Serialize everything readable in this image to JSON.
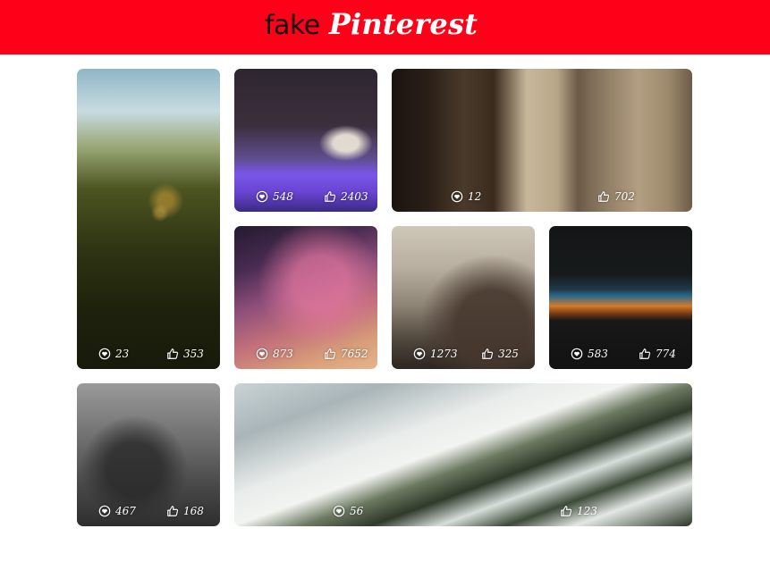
{
  "header": {
    "logo_word1": "fake",
    "logo_word2": "Pinterest",
    "background_color": "#ff0019"
  },
  "icons": {
    "likes": "heart-circle-icon",
    "thumbs": "thumbs-up-icon"
  },
  "tiles": [
    {
      "subject": "grass-field",
      "likes": "23",
      "thumbs": "353"
    },
    {
      "subject": "cathedral-bridge-night",
      "likes": "548",
      "thumbs": "2403"
    },
    {
      "subject": "city-buildings-fire-escape",
      "likes": "12",
      "thumbs": "702"
    },
    {
      "subject": "milky-way-sky",
      "likes": "873",
      "thumbs": "7652"
    },
    {
      "subject": "eiffel-tower-paris",
      "likes": "1273",
      "thumbs": "325"
    },
    {
      "subject": "mountain-sunset",
      "likes": "583",
      "thumbs": "774"
    },
    {
      "subject": "foggy-trees",
      "likes": "467",
      "thumbs": "168"
    },
    {
      "subject": "snowy-mountain-forest",
      "likes": "56",
      "thumbs": "123"
    }
  ]
}
